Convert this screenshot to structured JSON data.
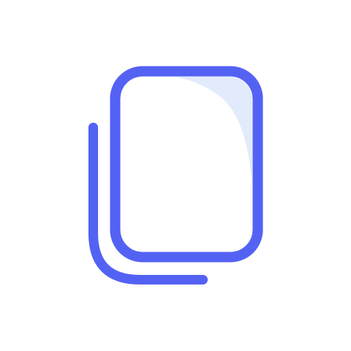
{
  "icon": {
    "name": "copy-icon",
    "colors": {
      "stroke": "#5462F4",
      "highlight": "#E1EBFB",
      "fill": "#FFFFFF",
      "background": "#FFFFFF"
    }
  }
}
